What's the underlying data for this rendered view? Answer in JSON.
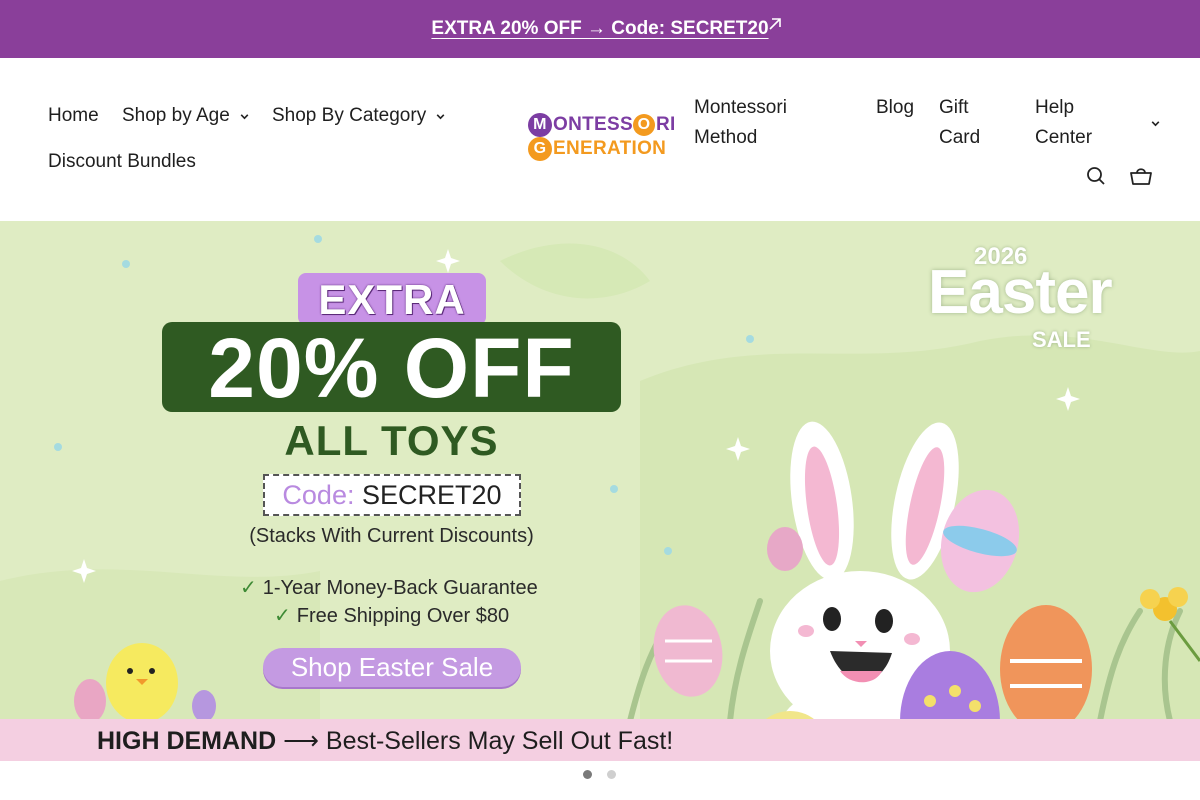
{
  "announcement": {
    "text": "EXTRA 20% OFF → Code: SECRET20",
    "icon": "arrow-up-right-icon"
  },
  "nav": {
    "left": [
      {
        "label": "Home"
      },
      {
        "label": "Shop by Age",
        "icon": "chevron-down-icon"
      },
      {
        "label": "Shop By Category",
        "icon": "chevron-down-icon"
      },
      {
        "label": "Discount Bundles"
      }
    ],
    "right": [
      {
        "line1": "Montessori",
        "line2": "Method"
      },
      {
        "line1": "Blog"
      },
      {
        "line1": "Gift",
        "line2": "Card"
      },
      {
        "line1": "Help",
        "line2": "Center",
        "icon": "chevron-down-icon"
      }
    ]
  },
  "logo": {
    "badge_top": "M",
    "top_mid": "ONTESS",
    "badge_o": "O",
    "top_end": "RI",
    "badge_bottom": "G",
    "bottom_rest": "ENERATION"
  },
  "header_icons": [
    "search-icon",
    "cart-icon"
  ],
  "hero": {
    "extra": "EXTRA",
    "discount": "20% OFF",
    "subject": "ALL TOYS",
    "code_label": "Code:",
    "code_value": "SECRET20",
    "stacks_note": "(Stacks With Current Discounts)",
    "perks": [
      "1-Year Money-Back Guarantee",
      "Free Shipping Over $80"
    ],
    "check_icon": "✓",
    "cta": "Shop Easter Sale",
    "badge": {
      "year": "2026",
      "word": "Easter",
      "sale": "SALE"
    },
    "demand": {
      "bold": "HIGH DEMAND",
      "arrow": "⟶",
      "rest": "Best-Sellers May Sell Out Fast!"
    }
  },
  "carousel": {
    "slides": 2,
    "active_index": 0
  },
  "colors": {
    "announcement_bg": "#8a3f9a",
    "hero_bg": "#dfecc3",
    "discount_box": "#2f5a22",
    "cta": "#c49ae2",
    "demand_bar": "#f4cfe1",
    "logo_purple": "#7c3da3",
    "logo_orange": "#f39a1f"
  }
}
